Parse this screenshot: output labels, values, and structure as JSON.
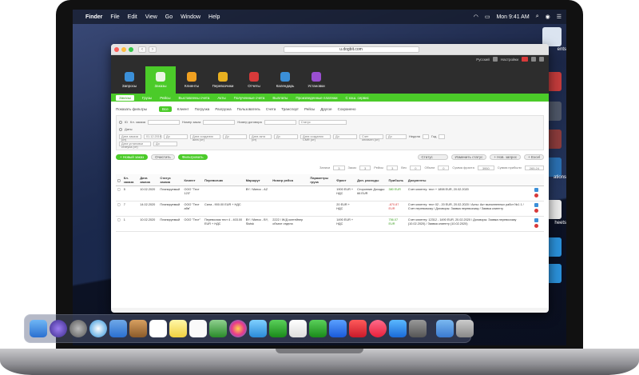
{
  "menubar": {
    "app": "Finder",
    "items": [
      "File",
      "Edit",
      "View",
      "Go",
      "Window",
      "Help"
    ],
    "clock": "Mon 9:41 AM"
  },
  "desktop": {
    "labels": [
      "ents",
      "ations",
      "heets"
    ]
  },
  "browser": {
    "url": "u.dogbit.com"
  },
  "app": {
    "top_labels": [
      "Русский",
      "Настройки"
    ],
    "modules": [
      "Запросы",
      "Заказы",
      "Клиенты",
      "Перевозчики",
      "Отчеты",
      "Календарь",
      "Установки"
    ],
    "subnav": [
      "Заказы",
      "Грузы",
      "Рейсы",
      "Выставлены счета",
      "Акты",
      "Полученные счета",
      "Выплаты",
      "Произведенные платежи",
      "С кэш. сервис"
    ],
    "filter_label": "Показать фильтры",
    "filter_buttons": [
      "Все",
      "Клиент",
      "Погрузка",
      "Разгрузка",
      "Пользователь",
      "Счета",
      "Транспорт",
      "Рейсы",
      "Другое",
      "Сохранено"
    ],
    "filters": {
      "row1": [
        "Кл. заказа",
        "Номер заказ",
        "Номер договора",
        "Статус"
      ],
      "row1_values": [
        "",
        "",
        "",
        "Статус"
      ],
      "row1_prefix": "ID",
      "dates_label": "Даты",
      "date_fields": [
        "Дата заказа (от)",
        "До",
        "Дата создания акта (от)",
        "До",
        "Дата акта (от)",
        "До",
        "Дата создания CMR (от)",
        "До",
        "Счет оплачен (от)",
        "До",
        "Неделя",
        "Год"
      ],
      "date_value": "01.12.2019",
      "date_row2": [
        "Дата установки статуса (от)",
        "До"
      ]
    },
    "actions": {
      "new_order": "+ Новый заказ",
      "clear": "Очистить",
      "filter": "Фильтровать",
      "select_status": "Статус",
      "change_status": "Изменить статус",
      "add_request": "+ Нов. запрос",
      "export": "+ Excel"
    },
    "totals": [
      {
        "label": "Записи",
        "value": "3"
      },
      {
        "label": "Заказ",
        "value": "3"
      },
      {
        "label": "Рейсы",
        "value": "3"
      },
      {
        "label": "Вес",
        "value": "0"
      },
      {
        "label": "Объем",
        "value": "0"
      },
      {
        "label": "Сумма фрахта",
        "value": "3950"
      },
      {
        "label": "Сумма прибыли",
        "value": "265.24"
      }
    ],
    "table": {
      "headers": [
        "Кл. заказа",
        "Дата заказа",
        "Статус заказа",
        "Клиент",
        "Перевозчик",
        "Маршрут",
        "Номер рейса",
        "Параметры груза",
        "Фрахт",
        "Доп. расходы",
        "Прибыль",
        "Документы"
      ],
      "rows": [
        {
          "id": "5",
          "date": "10.02.2020",
          "status": "Планируемый",
          "client": "ООО \"Тест 123\"",
          "carrier": "",
          "route": "BY / Минск - AZ",
          "trip": "",
          "cargo": "",
          "freight": "1900 EUR + НДС",
          "extra": "Сторонние Доходы: 66 EUR",
          "profit": "380 EUR",
          "docs": "Счет клиенту: тест + 1898 EUR, 20.02.2020"
        },
        {
          "id": "7",
          "date": "14.02.2020",
          "status": "Планируемый",
          "client": "ООО \"Тест абв\"",
          "carrier": "Сила - 900.00 EUR + НДС",
          "route": "",
          "trip": "",
          "cargo": "",
          "freight": "20 EUR + НДС",
          "extra": "",
          "profit": "-870.87 EUR",
          "docs": "Счет клиенту: тест 02 - 20 EUR, 20.02.2020 / Акты: Акт выполненных работ №1 1 / Счет перевозчику / Договоры: Заявка перевозчику / Заявка клиенту"
        },
        {
          "id": "1",
          "date": "10.02.2020",
          "status": "Планируемый",
          "client": "ООО \"Тест\"",
          "carrier": "Перевозчик тест 4 - 403.00 EUR + НДС",
          "route": "BY / Минск - BY, Slutsk",
          "trip": "2222 / Ж/Д контейнер объект отдела",
          "cargo": "",
          "freight": "1490 EUR + НДС",
          "extra": "",
          "profit": "756.07 EUR",
          "docs": "Счет клиенту: 12312 - 1490 EUR, 20.02.2020 / Договоры: Заявка перевозчику (10.02.2020) / Заявка клиенту (10.02.2020)"
        }
      ]
    }
  },
  "colors": {
    "accent": "#4bcb29",
    "dark": "#2d2d2d",
    "danger": "#d83a3a"
  }
}
